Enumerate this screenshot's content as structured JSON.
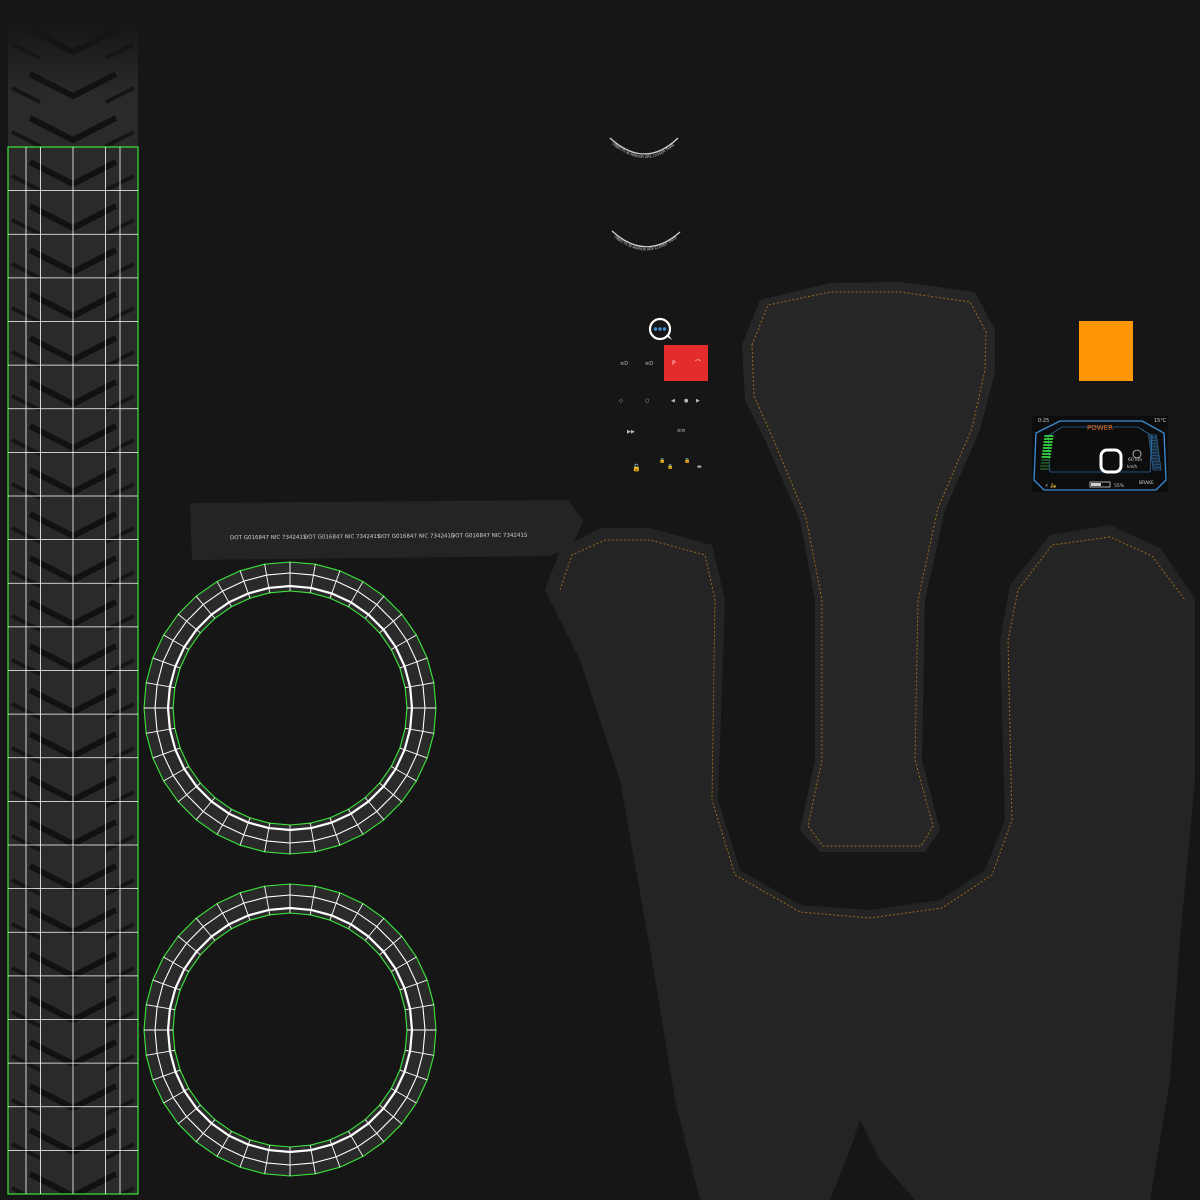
{
  "colors": {
    "background": "#161616",
    "panel": "#242424",
    "panel_edge": "#2b2b2b",
    "uv_wire": "#ffffff",
    "uv_border": "#39e639",
    "stitch": "#9a6a1e",
    "red_button": "#e52c2c",
    "orange_swatch": "#ff9606",
    "dash_blue": "#3a8fd8",
    "dash_green": "#2fbf3a",
    "dash_orange": "#e56b1f"
  },
  "tread_strip": {
    "rows": 24,
    "cols": 4
  },
  "rings": {
    "count": 2,
    "segments": 36
  },
  "sidewall_label": {
    "entries": [
      "DOT  G016847  NIC 7342415",
      "DOT  G016847  NIC 7342415",
      "DOT  G016847  NIC 7342415",
      "DOT  G016847  NIC 7342415"
    ],
    "separator": "-"
  },
  "warning_arcs": [
    "OBJECTS IN MIRROR ARE CLOSER THAN THEY APPEAR",
    "OBJECTS IN MIRROR ARE CLOSER THAN THEY APPEAR"
  ],
  "controls": {
    "icons": [
      "info-chat-icon",
      "headlight-icon",
      "headlight-icon",
      "hazard-icon",
      "horn-icon",
      "turn-left-icon",
      "turn-right-icon",
      "play-icon",
      "dot-icon",
      "lock-icon"
    ],
    "red_button_glyphs": [
      "P",
      "⌒"
    ]
  },
  "dashboard": {
    "time": "0:25",
    "temperature": "15°C",
    "mode_label": "POWER",
    "speed": "0",
    "range": "60 km",
    "battery": "55%",
    "brake_label": "BRAKE",
    "unit_label": "km/h",
    "battery_level": 0.55,
    "power_level": 0.7
  }
}
